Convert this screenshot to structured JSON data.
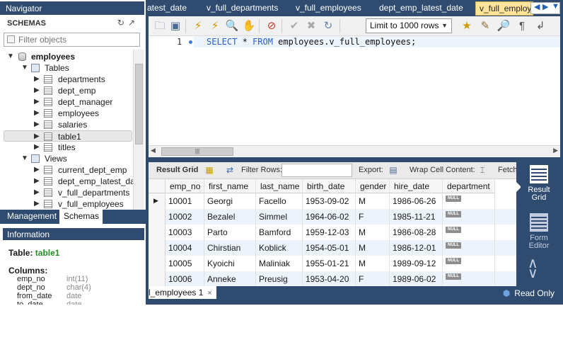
{
  "navigator": {
    "title": "Navigator",
    "schemas_label": "SCHEMAS",
    "filter_placeholder": "Filter objects",
    "tree": [
      {
        "label": "employees",
        "kind": "schema",
        "expanded": true
      },
      {
        "label": "Tables",
        "kind": "folder",
        "expanded": true
      },
      {
        "label": "departments",
        "kind": "table"
      },
      {
        "label": "dept_emp",
        "kind": "table"
      },
      {
        "label": "dept_manager",
        "kind": "table"
      },
      {
        "label": "employees",
        "kind": "table"
      },
      {
        "label": "salaries",
        "kind": "table"
      },
      {
        "label": "table1",
        "kind": "table",
        "selected": true
      },
      {
        "label": "titles",
        "kind": "table"
      },
      {
        "label": "Views",
        "kind": "folder",
        "expanded": true
      },
      {
        "label": "current_dept_emp",
        "kind": "view"
      },
      {
        "label": "dept_emp_latest_date",
        "kind": "view"
      },
      {
        "label": "v_full_departments",
        "kind": "view"
      },
      {
        "label": "v_full_employees",
        "kind": "view"
      }
    ],
    "bottom_tabs": {
      "management": "Management",
      "schemas": "Schemas"
    }
  },
  "information": {
    "header": "Information",
    "table_label": "Table:",
    "table_name": "table1",
    "columns_label": "Columns:",
    "columns": [
      {
        "name": "emp_no",
        "type": "int(11)"
      },
      {
        "name": "dept_no",
        "type": "char(4)"
      },
      {
        "name": "from_date",
        "type": "date"
      },
      {
        "name": "to_date",
        "type": "date"
      }
    ]
  },
  "tabs": [
    "atest_date",
    "v_full_departments",
    "v_full_employees",
    "dept_emp_latest_date",
    "v_full_employe"
  ],
  "active_tab": "v_full_employe",
  "toolbar": {
    "limit": "Limit to 1000 rows"
  },
  "editor": {
    "line_number": "1",
    "keyword1": "SELECT",
    "star": " * ",
    "keyword2": "FROM",
    "rest": " employees.v_full_employees;"
  },
  "result_toolbar": {
    "result_grid": "Result Grid",
    "filter_rows": "Filter Rows:",
    "export": "Export:",
    "wrap": "Wrap Cell Content:",
    "fetch": "Fetch"
  },
  "grid": {
    "columns": [
      "emp_no",
      "first_name",
      "last_name",
      "birth_date",
      "gender",
      "hire_date",
      "department"
    ],
    "null_label": "NULL",
    "rows": [
      [
        "10001",
        "Georgi",
        "Facello",
        "1953-09-02",
        "M",
        "1986-06-26"
      ],
      [
        "10002",
        "Bezalel",
        "Simmel",
        "1964-06-02",
        "F",
        "1985-11-21"
      ],
      [
        "10003",
        "Parto",
        "Bamford",
        "1959-12-03",
        "M",
        "1986-08-28"
      ],
      [
        "10004",
        "Chirstian",
        "Koblick",
        "1954-05-01",
        "M",
        "1986-12-01"
      ],
      [
        "10005",
        "Kyoichi",
        "Maliniak",
        "1955-01-21",
        "M",
        "1989-09-12"
      ],
      [
        "10006",
        "Anneke",
        "Preusig",
        "1953-04-20",
        "F",
        "1989-06-02"
      ]
    ]
  },
  "side_panel": {
    "result_grid": "Result Grid",
    "form_editor": "Form Editor"
  },
  "status": {
    "result_tab": "l_employees 1",
    "close": "×",
    "read_only": "Read Only"
  }
}
